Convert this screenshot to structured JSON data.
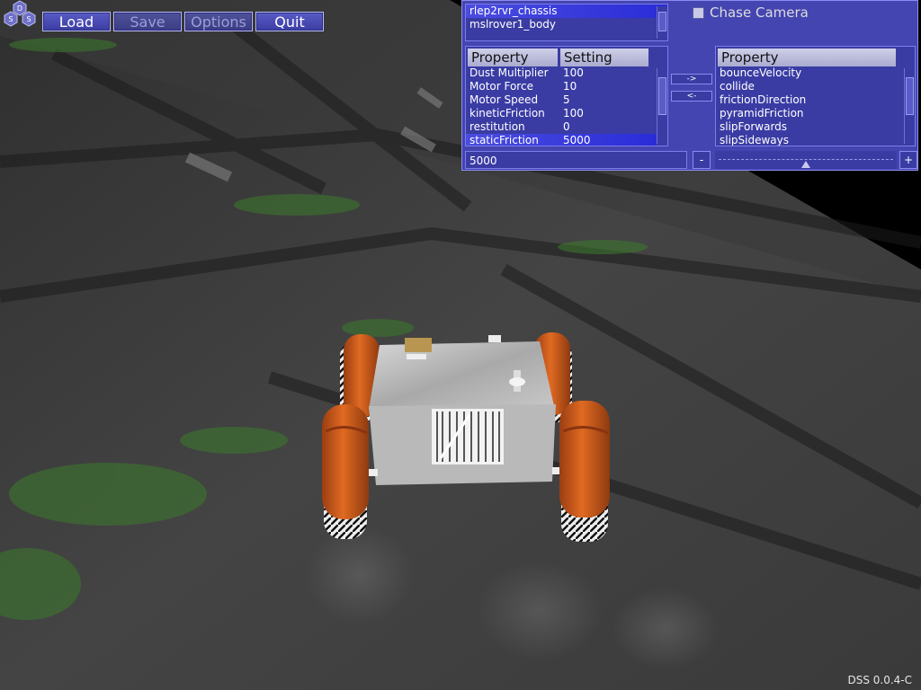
{
  "app": {
    "version": "DSS 0.0.4-C",
    "logo_letters": [
      "D",
      "S",
      "S"
    ]
  },
  "toolbar": {
    "buttons": [
      {
        "label": "Load",
        "enabled": true
      },
      {
        "label": "Save",
        "enabled": false
      },
      {
        "label": "Options",
        "enabled": false
      },
      {
        "label": "Quit",
        "enabled": true
      }
    ]
  },
  "panel": {
    "bodies": [
      "rlep2rvr_chassis",
      "mslrover1_body"
    ],
    "selected_body": "rlep2rvr_chassis",
    "chase_camera": {
      "label": "Chase Camera",
      "checked": false
    },
    "properties_table": {
      "headers": [
        "Property",
        "Setting"
      ],
      "rows": [
        {
          "property": "Dust Multiplier",
          "setting": "100"
        },
        {
          "property": "Motor Force",
          "setting": "10"
        },
        {
          "property": "Motor Speed",
          "setting": "5"
        },
        {
          "property": "kineticFriction",
          "setting": "100"
        },
        {
          "property": "restitution",
          "setting": "0"
        },
        {
          "property": "staticFriction",
          "setting": "5000"
        }
      ],
      "selected_row": "staticFriction"
    },
    "add_button": "->",
    "remove_button": "<-",
    "available_properties": {
      "header": "Property",
      "items": [
        "bounceVelocity",
        "collide",
        "frictionDirection",
        "pyramidFriction",
        "slipForwards",
        "slipSideways"
      ]
    },
    "value_field": "5000",
    "decrement_button": "-",
    "increment_button": "+",
    "slider_fraction": 0.5
  },
  "colors": {
    "panel_bg": "#4445b0",
    "selection": "#2a2cd8",
    "rover_wheel": "#d2601e",
    "terrain": "#3f3f3f"
  }
}
